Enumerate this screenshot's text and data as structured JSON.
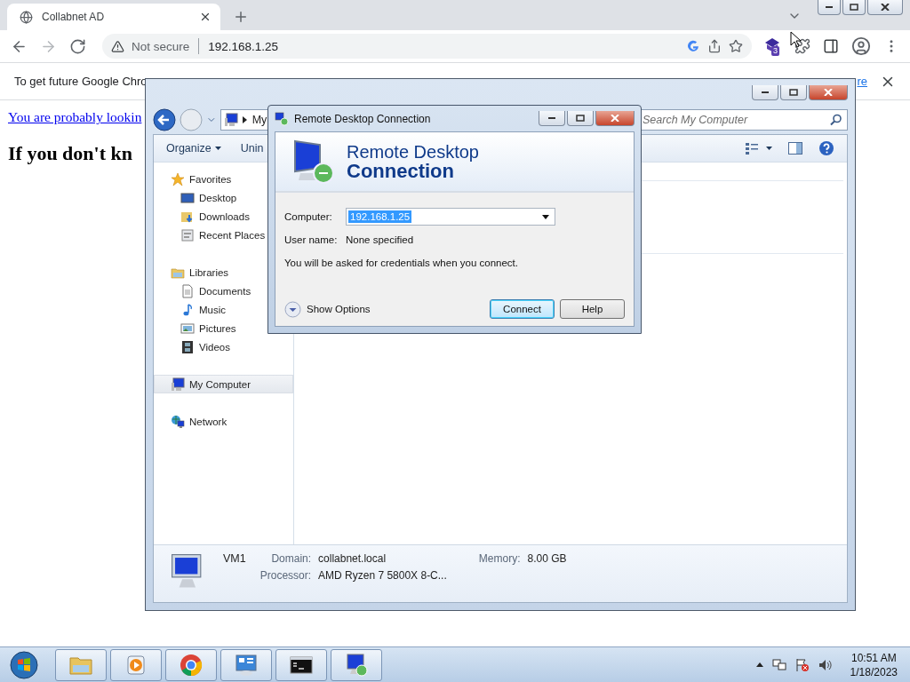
{
  "browser": {
    "tab": {
      "title": "Collabnet AD"
    },
    "nav_buttons": [
      {
        "kind": "back",
        "disabled": false
      },
      {
        "kind": "forward",
        "disabled": true
      },
      {
        "kind": "reload",
        "disabled": false
      }
    ],
    "omnibox": {
      "security": "Not secure",
      "url": "192.168.1.25"
    },
    "extension_badge": "3",
    "infobar": {
      "text": "To get future Google Chro",
      "link": "re"
    },
    "page": {
      "link": "You are probably lookin",
      "heading": "If you don't kn"
    }
  },
  "explorer": {
    "nav_buttons": [
      {
        "kind": "back",
        "disabled": false
      },
      {
        "kind": "forward",
        "disabled": true
      }
    ],
    "breadcrumb": "My",
    "search": {
      "placeholder": "Search My Computer"
    },
    "toolbar": [
      {
        "label": "Organize",
        "kind": "menu"
      },
      {
        "label": "Unin",
        "kind": "plain"
      }
    ],
    "nav": [
      {
        "label": "Favorites",
        "kind": "star",
        "selected": false,
        "children": [
          {
            "label": "Desktop",
            "kind": "desktop",
            "selected": false
          },
          {
            "label": "Downloads",
            "kind": "downloads",
            "selected": false
          },
          {
            "label": "Recent Places",
            "kind": "recent",
            "selected": false
          }
        ]
      },
      {
        "label": "Libraries",
        "kind": "libraries",
        "selected": false,
        "children": [
          {
            "label": "Documents",
            "kind": "documents",
            "selected": false
          },
          {
            "label": "Music",
            "kind": "music",
            "selected": false
          },
          {
            "label": "Pictures",
            "kind": "pictures",
            "selected": false
          },
          {
            "label": "Videos",
            "kind": "videos",
            "selected": false
          }
        ]
      },
      {
        "label": "My Computer",
        "kind": "computer",
        "selected": true
      },
      {
        "label": "Network",
        "kind": "network",
        "selected": false
      }
    ],
    "details": {
      "name": "VM1",
      "fields": [
        {
          "label": "Domain:",
          "value": "collabnet.local"
        },
        {
          "label": "Memory:",
          "value": "8.00 GB"
        },
        {
          "label": "Processor:",
          "value": "AMD Ryzen 7 5800X 8-C..."
        }
      ]
    }
  },
  "rdc": {
    "title": "Remote Desktop Connection",
    "banner": [
      "Remote Desktop",
      "Connection"
    ],
    "computer": {
      "label": "Computer:",
      "value": "192.168.1.25",
      "value_selected": true
    },
    "user": {
      "label": "User name:",
      "value": "None specified"
    },
    "message": "You will be asked for credentials when you connect.",
    "options": "Show Options",
    "buttons": [
      {
        "label": "Connect",
        "default": true
      },
      {
        "label": "Help",
        "default": false
      }
    ]
  },
  "taskbar": {
    "apps": [
      {
        "kind": "explorer"
      },
      {
        "kind": "media"
      },
      {
        "kind": "chrome"
      },
      {
        "kind": "control"
      },
      {
        "kind": "cmd"
      },
      {
        "kind": "rdc"
      }
    ],
    "time": "10:51 AM",
    "date": "1/18/2023"
  }
}
